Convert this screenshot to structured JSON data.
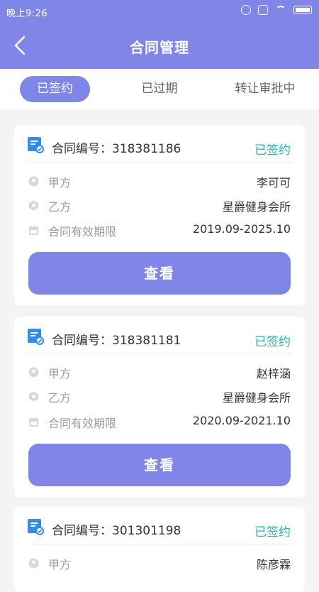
{
  "status_bar": {
    "time": "晚上9:26"
  },
  "header": {
    "title": "合同管理"
  },
  "tabs": [
    {
      "label": "已签约",
      "active": true
    },
    {
      "label": "已过期",
      "active": false
    },
    {
      "label": "转让审批中",
      "active": false
    }
  ],
  "field_labels": {
    "party_a": "甲方",
    "party_b": "乙方",
    "validity": "合同有效期限"
  },
  "contracts": [
    {
      "number_label": "合同编号：318381186",
      "status": "已签约",
      "party_a": "李可可",
      "party_b": "星爵健身会所",
      "validity": "2019.09-2025.10",
      "button": "查看"
    },
    {
      "number_label": "合同编号：318381181",
      "status": "已签约",
      "party_a": "赵梓涵",
      "party_b": "星爵健身会所",
      "validity": "2020.09-2021.10",
      "button": "查看"
    },
    {
      "number_label": "合同编号：301301198",
      "status": "已签约",
      "party_a": "陈彦霖"
    }
  ],
  "colors": {
    "primary": "#7f86e8",
    "status_green": "#2bb3ad",
    "icon_blue": "#2f8cf0"
  }
}
